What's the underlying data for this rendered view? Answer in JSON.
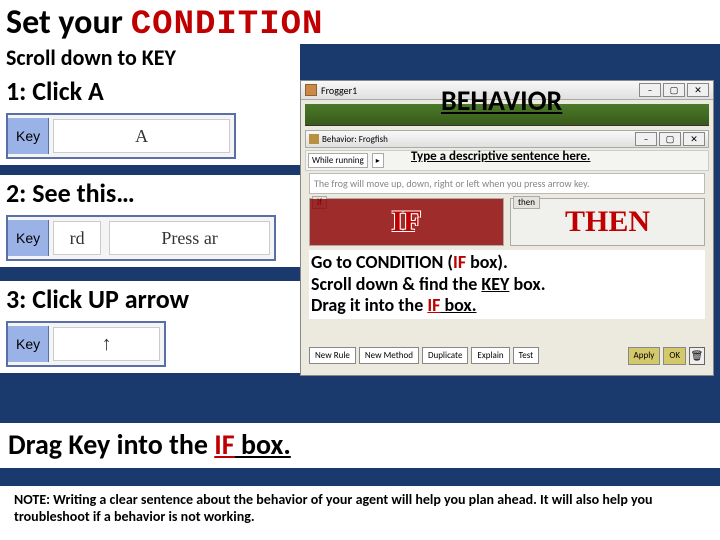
{
  "title": {
    "set_your": "Set your",
    "condition": "CONDITION"
  },
  "scroll_line": "Scroll down to KEY",
  "steps": {
    "s1": "1:  Click A",
    "s2": "2:  See this…",
    "s3": "3:  Click UP arrow"
  },
  "keybox": {
    "tab": "Key",
    "field1": "A",
    "field2_left": "rd",
    "field2_right": "Press ar",
    "field3": "↑"
  },
  "right": {
    "outer_title": "Frogger1",
    "behavior_label": "BEHAVIOR",
    "inner_title": "Behavior: Frogfish",
    "toolbar_running": "While running",
    "desc_label": "Type a descriptive sentence here.",
    "sentence": "The frog will move up, down, right or left when you press arrow key.",
    "if_tab": "if",
    "then_tab": "then",
    "if_label": "IF",
    "then_label": "THEN",
    "instr_l1a": "Go to CONDITION  (",
    "instr_l1_if": "IF",
    "instr_l1b": " box).",
    "instr_l2a": "Scroll down & find the ",
    "instr_l2_key": "KEY",
    "instr_l2b": " box.",
    "instr_l3a": "Drag it into the ",
    "instr_l3_if": "IF",
    "instr_l3b": " box.",
    "btn_newrule": "New Rule",
    "btn_newmethod": "New Method",
    "btn_duplicate": "Duplicate",
    "btn_explain": "Explain",
    "btn_test": "Test",
    "btn_apply": "Apply",
    "btn_ok": "OK"
  },
  "drag_line": {
    "a": "Drag Key into the ",
    "if": "IF",
    "b": " box."
  },
  "note": "NOTE:  Writing a clear sentence about the behavior of your agent will help you plan ahead.  It will also help you troubleshoot if a behavior is not working."
}
